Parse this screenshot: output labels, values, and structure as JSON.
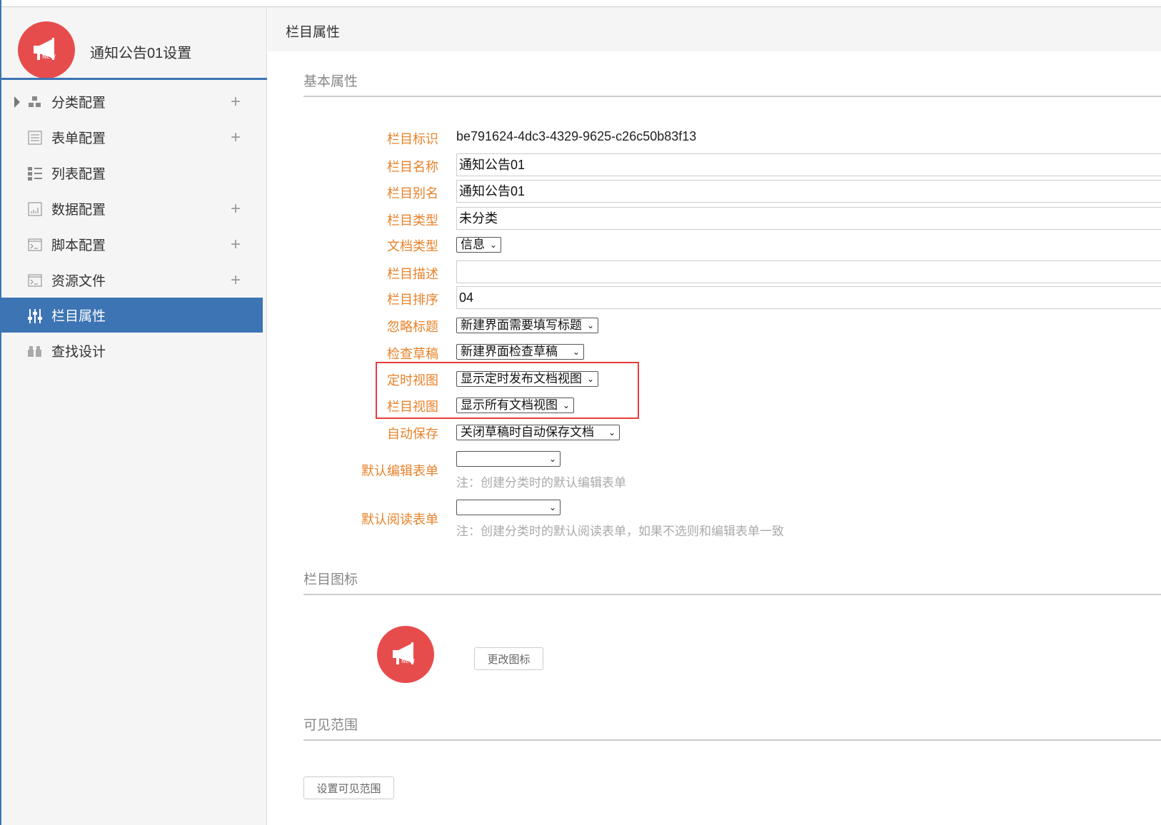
{
  "sidebar": {
    "title": "通知公告01设置",
    "items": [
      {
        "label": "分类配置",
        "icon": "category-icon",
        "plus": "+"
      },
      {
        "label": "表单配置",
        "icon": "form-icon",
        "plus": "+"
      },
      {
        "label": "列表配置",
        "icon": "list-icon"
      },
      {
        "label": "数据配置",
        "icon": "chart-icon",
        "plus": "+"
      },
      {
        "label": "脚本配置",
        "icon": "terminal-icon",
        "plus": "+"
      },
      {
        "label": "资源文件",
        "icon": "terminal-icon",
        "plus": "+"
      },
      {
        "label": "栏目属性",
        "icon": "sliders-icon",
        "active": true
      },
      {
        "label": "查找设计",
        "icon": "binoculars-icon"
      }
    ]
  },
  "main": {
    "title": "栏目属性",
    "basic": {
      "heading": "基本属性",
      "id_label": "栏目标识",
      "id_value": "be791624-4dc3-4329-9625-c26c50b83f13",
      "name_label": "栏目名称",
      "name_value": "通知公告01",
      "alias_label": "栏目别名",
      "alias_value": "通知公告01",
      "type_label": "栏目类型",
      "type_value": "未分类",
      "doctype_label": "文档类型",
      "doctype_value": "信息",
      "desc_label": "栏目描述",
      "desc_value": "",
      "order_label": "栏目排序",
      "order_value": "04",
      "ignore_label": "忽略标题",
      "ignore_value": "新建界面需要填写标题",
      "draft_label": "检查草稿",
      "draft_value": "新建界面检查草稿",
      "timed_label": "定时视图",
      "timed_value": "显示定时发布文档视图",
      "view_label": "栏目视图",
      "view_value": "显示所有文档视图",
      "autosave_label": "自动保存",
      "autosave_value": "关闭草稿时自动保存文档",
      "editform_label": "默认编辑表单",
      "editform_value": "",
      "editform_note": "注：创建分类时的默认编辑表单",
      "readform_label": "默认阅读表单",
      "readform_value": "",
      "readform_note": "注：创建分类时的默认阅读表单，如果不选则和编辑表单一致"
    },
    "icon": {
      "heading": "栏目图标",
      "change_button": "更改图标",
      "logo_text": "NEW"
    },
    "scope": {
      "heading": "可见范围",
      "set_button": "设置可见范围"
    }
  },
  "colors": {
    "accent": "#3c74b4",
    "label": "#e8822a",
    "logo": "#e74c4c",
    "highlight": "#e73c3c"
  }
}
